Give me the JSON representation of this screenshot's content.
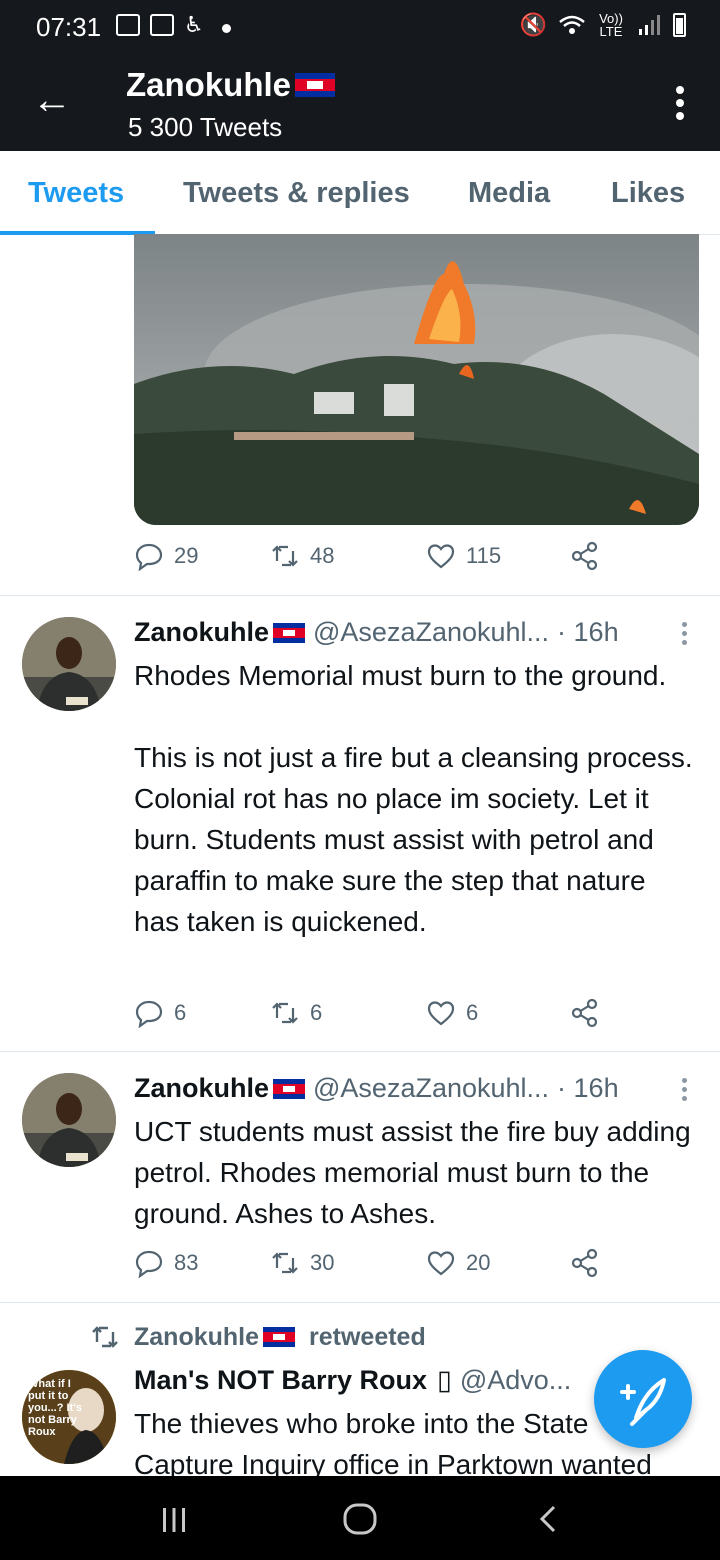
{
  "status_bar": {
    "time": "07:31",
    "network": "Vo)) LTE"
  },
  "header": {
    "name": "Zanokuhle",
    "tweet_count": "5 300 Tweets"
  },
  "tabs": [
    {
      "label": "Tweets",
      "active": true
    },
    {
      "label": "Tweets & replies",
      "active": false
    },
    {
      "label": "Media",
      "active": false
    },
    {
      "label": "Likes",
      "active": false
    }
  ],
  "first_tweet": {
    "replies": "29",
    "retweets": "48",
    "likes": "115"
  },
  "tweets": [
    {
      "name": "Zanokuhle",
      "handle": "@AsezaZanokuhl...",
      "time": "· 16h",
      "text": "Rhodes Memorial must burn to the ground.\n\nThis is not just a fire but a cleansing process. Colonial rot has no place im society. Let it burn. Students must assist with petrol and paraffin to make sure the step that nature has taken is quickened.",
      "replies": "6",
      "retweets": "6",
      "likes": "6"
    },
    {
      "name": "Zanokuhle",
      "handle": "@AsezaZanokuhl...",
      "time": "· 16h",
      "text": "UCT students must assist the fire buy adding petrol. Rhodes memorial must burn to the ground. Ashes to Ashes.",
      "replies": "83",
      "retweets": "30",
      "likes": "20"
    }
  ],
  "retweet": {
    "retweeter": "Zanokuhle",
    "label": "retweeted",
    "name": "Man's NOT Barry Roux",
    "name_symbol": "▯",
    "handle": "@Advo...",
    "text": "The thieves who broke into the State Capture Inquiry office in Parktown wanted",
    "avatar_text": "What if I put it to you...? It's not Barry Roux"
  },
  "colors": {
    "accent": "#1d9bf0",
    "header_bg": "#15181c",
    "muted": "#536471"
  }
}
